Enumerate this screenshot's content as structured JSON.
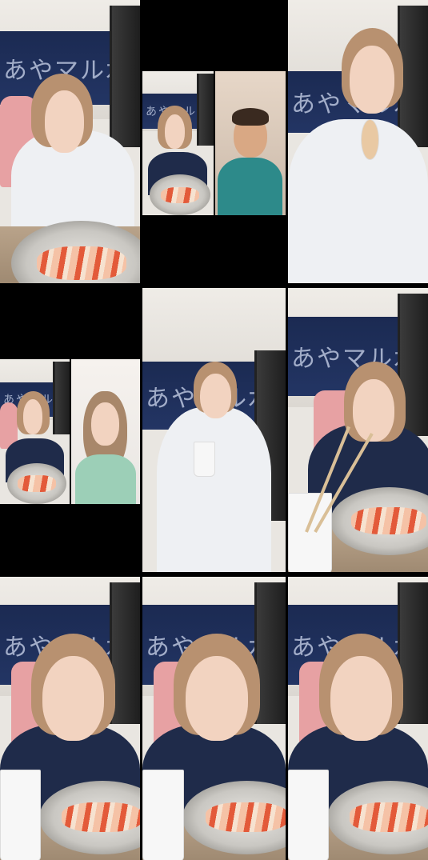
{
  "banner_text": "あやマル水産",
  "tiles": [
    {
      "id": "t1",
      "layout": "full",
      "pose": "white-robe-stretch"
    },
    {
      "id": "t2",
      "layout": "split-top",
      "pose": "collab-man"
    },
    {
      "id": "t3",
      "layout": "full",
      "pose": "white-robe-microphone"
    },
    {
      "id": "t4",
      "layout": "split-mid",
      "pose": "collab-woman"
    },
    {
      "id": "t5",
      "layout": "full",
      "pose": "white-robe-cup"
    },
    {
      "id": "t6",
      "layout": "full",
      "pose": "dark-robe-hand-on-head"
    },
    {
      "id": "t7",
      "layout": "full",
      "pose": "dark-robe-closeup"
    },
    {
      "id": "t8",
      "layout": "full",
      "pose": "dark-robe-closeup"
    },
    {
      "id": "t9",
      "layout": "full",
      "pose": "dark-robe-closeup"
    }
  ],
  "colors": {
    "banner": "#1b2a52",
    "plate": "#c9c7c2",
    "salmon": "#e35a3a",
    "chair": "#e7a1a3"
  }
}
